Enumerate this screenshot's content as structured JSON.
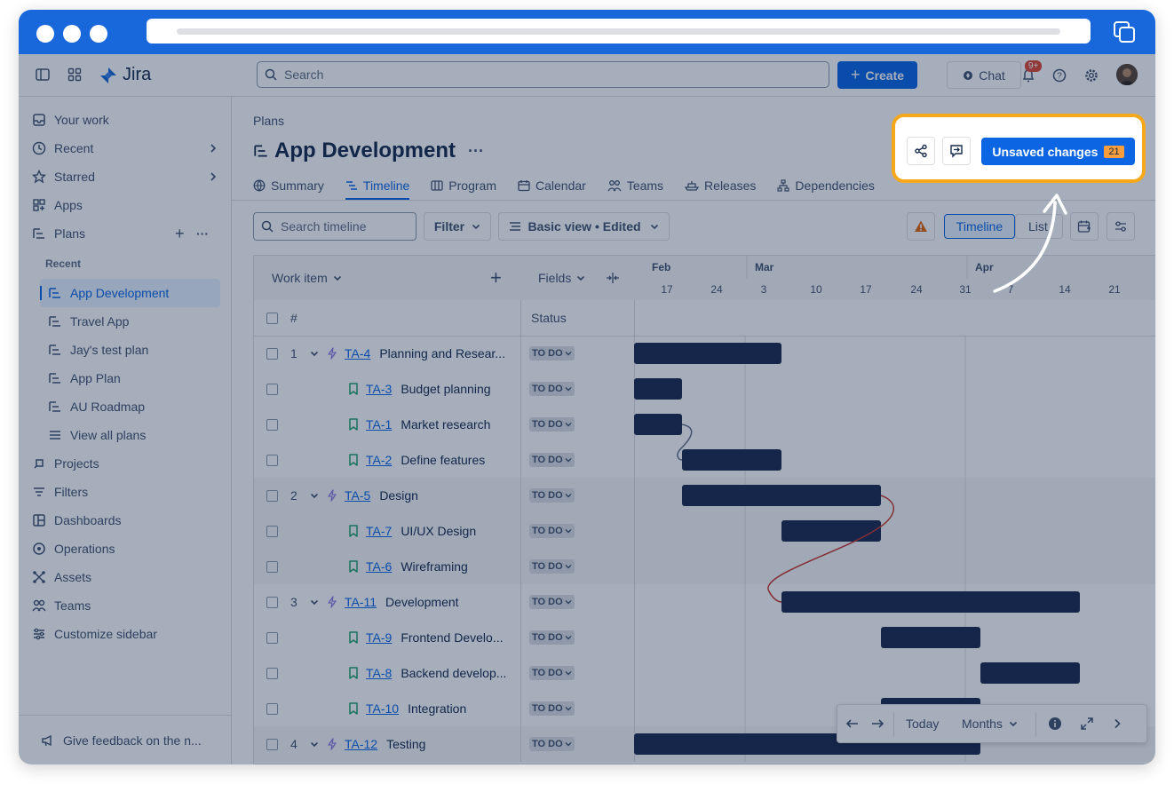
{
  "nav": {
    "search_placeholder": "Search",
    "create_label": "Create",
    "chat_label": "Chat",
    "notification_badge": "9+",
    "logo_text": "Jira"
  },
  "sidebar": {
    "items": [
      {
        "label": "Your work"
      },
      {
        "label": "Recent"
      },
      {
        "label": "Starred"
      },
      {
        "label": "Apps"
      },
      {
        "label": "Plans"
      }
    ],
    "recent_label": "Recent",
    "plans": [
      {
        "label": "App Development"
      },
      {
        "label": "Travel App"
      },
      {
        "label": "Jay's test plan"
      },
      {
        "label": "App Plan"
      },
      {
        "label": "AU Roadmap"
      },
      {
        "label": "View all plans"
      }
    ],
    "more_items": [
      {
        "label": "Projects"
      },
      {
        "label": "Filters"
      },
      {
        "label": "Dashboards"
      },
      {
        "label": "Operations"
      },
      {
        "label": "Assets"
      },
      {
        "label": "Teams"
      },
      {
        "label": "Customize sidebar"
      }
    ],
    "feedback": "Give feedback on the n..."
  },
  "page": {
    "breadcrumb": "Plans",
    "title": "App Development",
    "more": "···",
    "tabs": [
      {
        "label": "Summary"
      },
      {
        "label": "Timeline"
      },
      {
        "label": "Program"
      },
      {
        "label": "Calendar"
      },
      {
        "label": "Teams"
      },
      {
        "label": "Releases"
      },
      {
        "label": "Dependencies"
      }
    ],
    "unsaved_label": "Unsaved changes",
    "unsaved_count": "21"
  },
  "toolbar": {
    "search_placeholder": "Search timeline",
    "filter_label": "Filter",
    "view_label": "Basic view • Edited",
    "timeline_label": "Timeline",
    "list_label": "List"
  },
  "grid": {
    "work_item_header": "Work item",
    "fields_header": "Fields",
    "hash": "#",
    "status_header": "Status",
    "months": [
      "Feb",
      "Mar",
      "Apr"
    ],
    "days": [
      "17",
      "24",
      "3",
      "10",
      "17",
      "24",
      "31",
      "7",
      "14",
      "21"
    ],
    "rows": [
      {
        "num": "1",
        "key": "TA-4",
        "summary": "Planning and Resear...",
        "status": "TO DO"
      },
      {
        "num": "",
        "key": "TA-3",
        "summary": "Budget planning",
        "status": "TO DO"
      },
      {
        "num": "",
        "key": "TA-1",
        "summary": "Market research",
        "status": "TO DO"
      },
      {
        "num": "",
        "key": "TA-2",
        "summary": "Define features",
        "status": "TO DO"
      },
      {
        "num": "2",
        "key": "TA-5",
        "summary": "Design",
        "status": "TO DO"
      },
      {
        "num": "",
        "key": "TA-7",
        "summary": "UI/UX Design",
        "status": "TO DO"
      },
      {
        "num": "",
        "key": "TA-6",
        "summary": "Wireframing",
        "status": "TO DO"
      },
      {
        "num": "3",
        "key": "TA-11",
        "summary": "Development",
        "status": "TO DO"
      },
      {
        "num": "",
        "key": "TA-9",
        "summary": "Frontend Develo...",
        "status": "TO DO"
      },
      {
        "num": "",
        "key": "TA-8",
        "summary": "Backend develop...",
        "status": "TO DO"
      },
      {
        "num": "",
        "key": "TA-10",
        "summary": "Integration",
        "status": "TO DO"
      },
      {
        "num": "4",
        "key": "TA-12",
        "summary": "Testing",
        "status": "TO DO"
      }
    ]
  },
  "bottom": {
    "today": "Today",
    "months": "Months"
  }
}
